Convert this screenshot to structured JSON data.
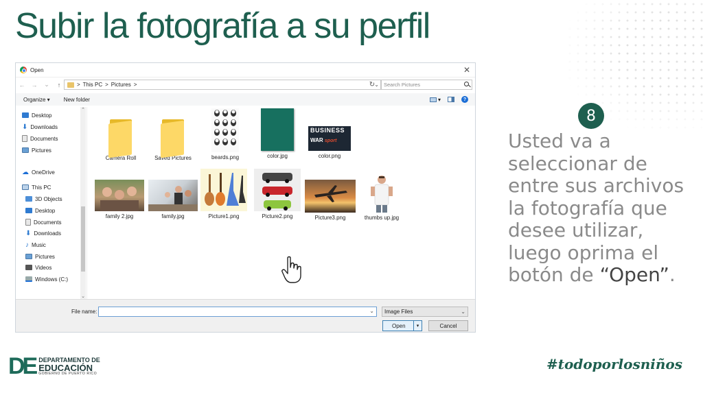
{
  "slide": {
    "title": "Subir la fotografía a su perfil",
    "step_number": "8",
    "instruction_pre": "Usted va a seleccionar de entre sus archivos la fotografía que desee utilizar, luego oprima el botón de ",
    "instruction_emph": "“Open”",
    "instruction_post": ".",
    "hashtag": "#todoporlosniños",
    "logo": {
      "mark": "DE",
      "line1": "DEPARTAMENTO DE",
      "line2": "EDUCACIÓN",
      "line3": "GOBIERNO DE PUERTO RICO"
    }
  },
  "dialog": {
    "title": "Open",
    "close_glyph": "✕",
    "nav": {
      "back": "←",
      "forward": "→",
      "dropdown": "⌄",
      "up": "↑"
    },
    "breadcrumb": [
      "This PC",
      "Pictures"
    ],
    "breadcrumb_sep": ">",
    "refresh_glyph": "↻",
    "search_placeholder": "Search Pictures",
    "toolbar": {
      "organize": "Organize ▾",
      "new_folder": "New folder",
      "view_dd": "▾",
      "help": "?"
    },
    "sidebar": {
      "quick_access": [
        "Desktop",
        "Downloads",
        "Documents",
        "Pictures"
      ],
      "onedrive": "OneDrive",
      "this_pc": "This PC",
      "this_pc_children": [
        "3D Objects",
        "Desktop",
        "Documents",
        "Downloads",
        "Music",
        "Pictures",
        "Videos",
        "Windows (C:)"
      ]
    },
    "scroll_up": "⌃",
    "scroll_down": "⌄",
    "files": [
      {
        "name": "Camera Roll",
        "kind": "folder"
      },
      {
        "name": "Saved Pictures",
        "kind": "folder"
      },
      {
        "name": "beards.png",
        "kind": "image"
      },
      {
        "name": "color.jpg",
        "kind": "image"
      },
      {
        "name": "color.png",
        "kind": "image"
      },
      {
        "name": "family 2.jpg",
        "kind": "image"
      },
      {
        "name": "family.jpg",
        "kind": "image"
      },
      {
        "name": "Picture1.png",
        "kind": "image"
      },
      {
        "name": "Picture2.png",
        "kind": "image"
      },
      {
        "name": "Picture3.png",
        "kind": "image"
      },
      {
        "name": "thumbs up.jpg",
        "kind": "image"
      }
    ],
    "color_png_text": {
      "line1": "BUSINESS",
      "line2": "WAR",
      "line3": "sport"
    },
    "file_name_label": "File name:",
    "file_name_value": "",
    "file_name_dd": "⌄",
    "file_type": "Image Files",
    "file_type_dd": "⌄",
    "open_button": "Open",
    "open_split": "▾",
    "cancel_button": "Cancel"
  }
}
